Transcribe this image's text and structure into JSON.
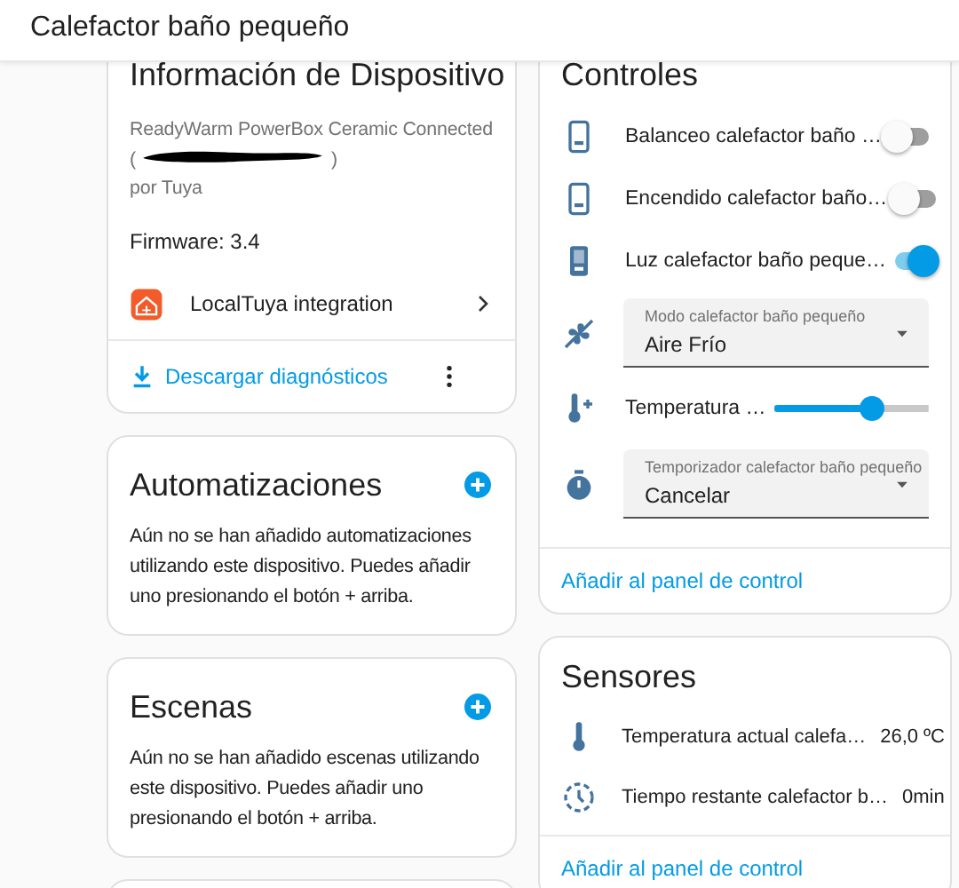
{
  "header": {
    "title": "Calefactor baño pequeño"
  },
  "device_info": {
    "title": "Información de Dispositivo",
    "model": "ReadyWarm PowerBox Ceramic Connected",
    "serial": {
      "open": "(",
      "close": ")",
      "redacted": true
    },
    "manufacturer": "por Tuya",
    "firmware": "Firmware: 3.4",
    "integration": "LocalTuya integration",
    "download": "Descargar diagnósticos"
  },
  "automations": {
    "title": "Automatizaciones",
    "text": "Aún no se han añadido automatizaciones utilizando este dispositivo. Puedes añadir uno presionando el botón + arriba."
  },
  "scenes": {
    "title": "Escenas",
    "text": "Aún no se han añadido escenas utilizando este dispositivo. Puedes añadir uno presionando el botón + arriba."
  },
  "controls": {
    "title": "Controles",
    "entities": [
      {
        "kind": "switch",
        "name": "Balanceo calefactor baño …",
        "on": false
      },
      {
        "kind": "switch",
        "name": "Encendido calefactor baño…",
        "on": false
      },
      {
        "kind": "switch",
        "name": "Luz calefactor baño peque…",
        "on": true
      },
      {
        "kind": "select",
        "label": "Modo calefactor baño pequeño",
        "value": "Aire Frío"
      },
      {
        "kind": "slider",
        "name": "Temperatura …",
        "level": 0.65
      },
      {
        "kind": "select",
        "label": "Temporizador calefactor baño pequeño",
        "value": "Cancelar"
      }
    ],
    "link": "Añadir al panel de control"
  },
  "sensors": {
    "title": "Sensores",
    "entities": [
      {
        "kind": "temperature",
        "name": "Temperatura actual calefa…",
        "value": "26,0 ºC"
      },
      {
        "kind": "timer",
        "name": "Tiempo restante calefactor b…",
        "value": "0min"
      }
    ],
    "link": "Añadir al panel de control"
  }
}
